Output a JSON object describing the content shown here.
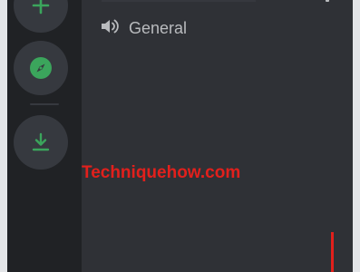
{
  "server_rail": {
    "buttons": [
      {
        "icon": "plus-icon",
        "color": "#3ba55c"
      },
      {
        "icon": "compass-icon",
        "color": "#3ba55c"
      },
      {
        "icon": "download-icon",
        "color": "#3ba55c"
      }
    ]
  },
  "channels": [
    {
      "icon": "speaker-icon",
      "name": "General"
    }
  ],
  "watermark": {
    "text": "Techniquehow.com",
    "color": "#e2201c"
  }
}
